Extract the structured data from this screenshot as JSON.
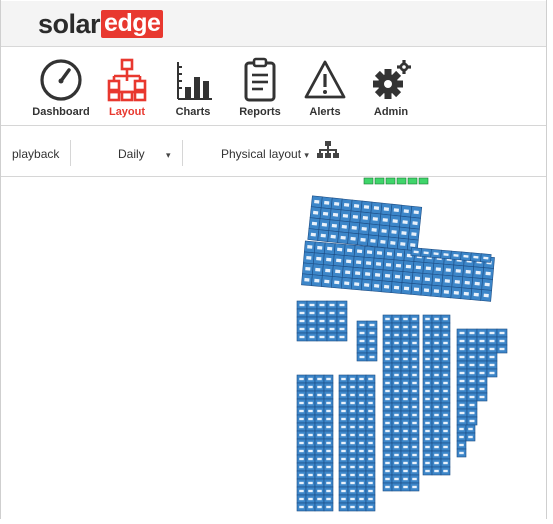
{
  "brand": {
    "logo_text_1": "solar",
    "logo_text_2": "edge",
    "accent": "#e8382f"
  },
  "nav": {
    "items": [
      {
        "label": "Dashboard",
        "icon": "dashboard-gauge-icon",
        "active": false
      },
      {
        "label": "Layout",
        "icon": "layout-hierarchy-icon",
        "active": true
      },
      {
        "label": "Charts",
        "icon": "bar-chart-icon",
        "active": false
      },
      {
        "label": "Reports",
        "icon": "clipboard-report-icon",
        "active": false
      },
      {
        "label": "Alerts",
        "icon": "warning-triangle-icon",
        "active": false
      },
      {
        "label": "Admin",
        "icon": "gear-admin-icon",
        "active": false
      }
    ]
  },
  "toolbar": {
    "playback_label": "playback",
    "period_label": "Daily",
    "layout_label": "Physical layout",
    "layout_caret": "▾",
    "period_caret": "▾"
  },
  "layout_view": {
    "panel_color": "#3c86c9",
    "panel_border": "#1d4e86",
    "inverter_color": "#3fd56a"
  }
}
